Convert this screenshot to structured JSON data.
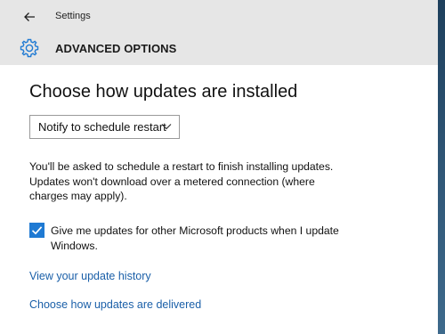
{
  "titlebar": {
    "back_icon": "back-arrow-icon",
    "title": "Settings"
  },
  "header": {
    "icon": "gear-icon",
    "icon_color": "#1f7ad3",
    "title": "ADVANCED OPTIONS"
  },
  "main": {
    "section_title": "Choose how updates are installed",
    "install_mode": {
      "selected": "Notify to schedule restart",
      "icon": "chevron-down-icon"
    },
    "description_lines": [
      "You'll be asked to schedule a restart to finish installing updates.",
      "Updates won't download over a metered connection (where",
      "charges may apply)."
    ],
    "other_products_checkbox": {
      "checked": true,
      "accent_color": "#1f7ad3",
      "label": "Give me updates for other Microsoft products when I update Windows."
    },
    "links": {
      "update_history": "View your update history",
      "delivery": "Choose how updates are delivered"
    },
    "link_color": "#1a5fa8"
  }
}
